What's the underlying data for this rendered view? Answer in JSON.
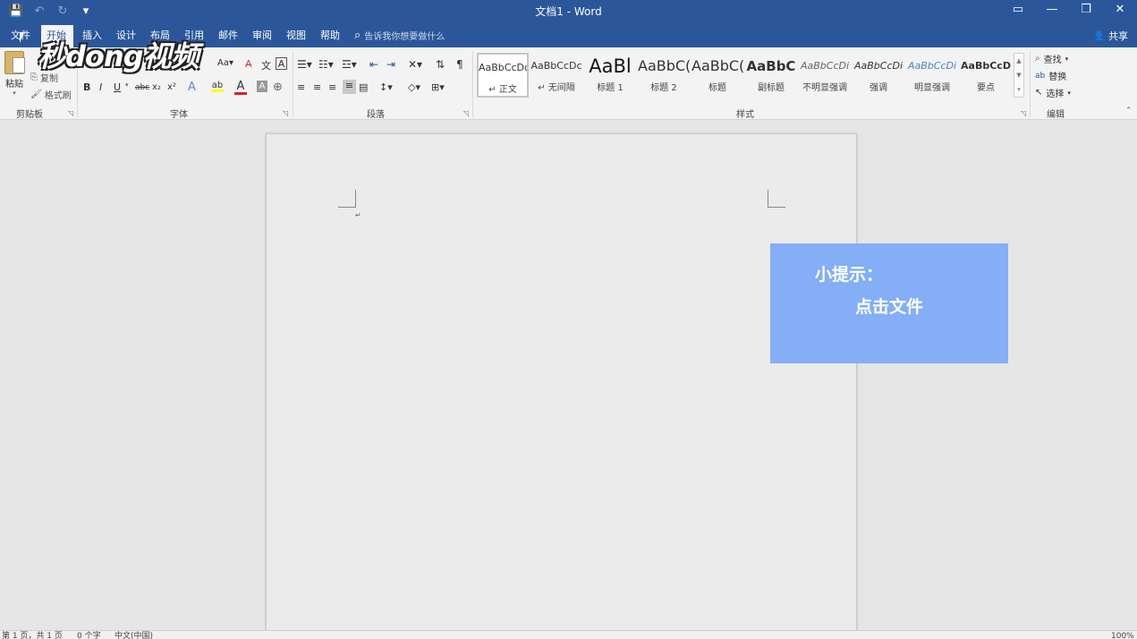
{
  "titlebar": {
    "title": "文档1  -  Word",
    "qat": {
      "save_icon": "💾",
      "undo_icon": "↶",
      "redo_icon": "↻",
      "more_icon": "▾"
    },
    "window_buttons": {
      "ribbon_display": "▭",
      "minimize": "—",
      "restore": "❐",
      "close": "✕"
    }
  },
  "tabs": [
    "文件",
    "开始",
    "插入",
    "设计",
    "布局",
    "引用",
    "邮件",
    "审阅",
    "视图",
    "帮助"
  ],
  "tellme": {
    "icon": "⌕",
    "text": "告诉我你想要做什么"
  },
  "share": {
    "icon": "👤",
    "label": "共享"
  },
  "clipboard": {
    "paste": "粘贴",
    "copy": "复制",
    "format_painter": "格式刷",
    "group": "剪贴板"
  },
  "font": {
    "group": "字体",
    "size_btn": "Aa▾",
    "clear": "A̶",
    "phonetic": "文",
    "border": "A",
    "bold": "B",
    "italic": "I",
    "underline": "U",
    "strike": "abc",
    "sub": "x₂",
    "sup": "x²",
    "effects": "A",
    "highlight": "ab",
    "font_color": "A",
    "shading": "A",
    "enclose": "⊕"
  },
  "paragraph": {
    "group": "段落"
  },
  "styles": {
    "group": "样式",
    "items": [
      {
        "preview": "AaBbCcDc",
        "name": "↵ 正文"
      },
      {
        "preview": "AaBbCcDc",
        "name": "↵ 无间隔"
      },
      {
        "preview": "AaBl",
        "name": "标题 1"
      },
      {
        "preview": "AaBbC(",
        "name": "标题 2"
      },
      {
        "preview": "AaBbC(",
        "name": "标题"
      },
      {
        "preview": "AaBbC",
        "name": "副标题"
      },
      {
        "preview": "AaBbCcDi",
        "name": "不明显强调"
      },
      {
        "preview": "AaBbCcDi",
        "name": "强调"
      },
      {
        "preview": "AaBbCcDi",
        "name": "明显强调"
      },
      {
        "preview": "AaBbCcD",
        "name": "要点"
      }
    ]
  },
  "editing": {
    "group": "编辑",
    "find": "查找",
    "replace": "替换",
    "select": "选择"
  },
  "document": {
    "para_mark": "↵"
  },
  "tip": {
    "line1": "小提示：",
    "line2": "点击文件"
  },
  "watermark": "秒dong视频",
  "status": {
    "page": "第 1 页，共 1 页",
    "words": "0 个字",
    "lang": "中文(中国)",
    "zoom": "100%"
  }
}
